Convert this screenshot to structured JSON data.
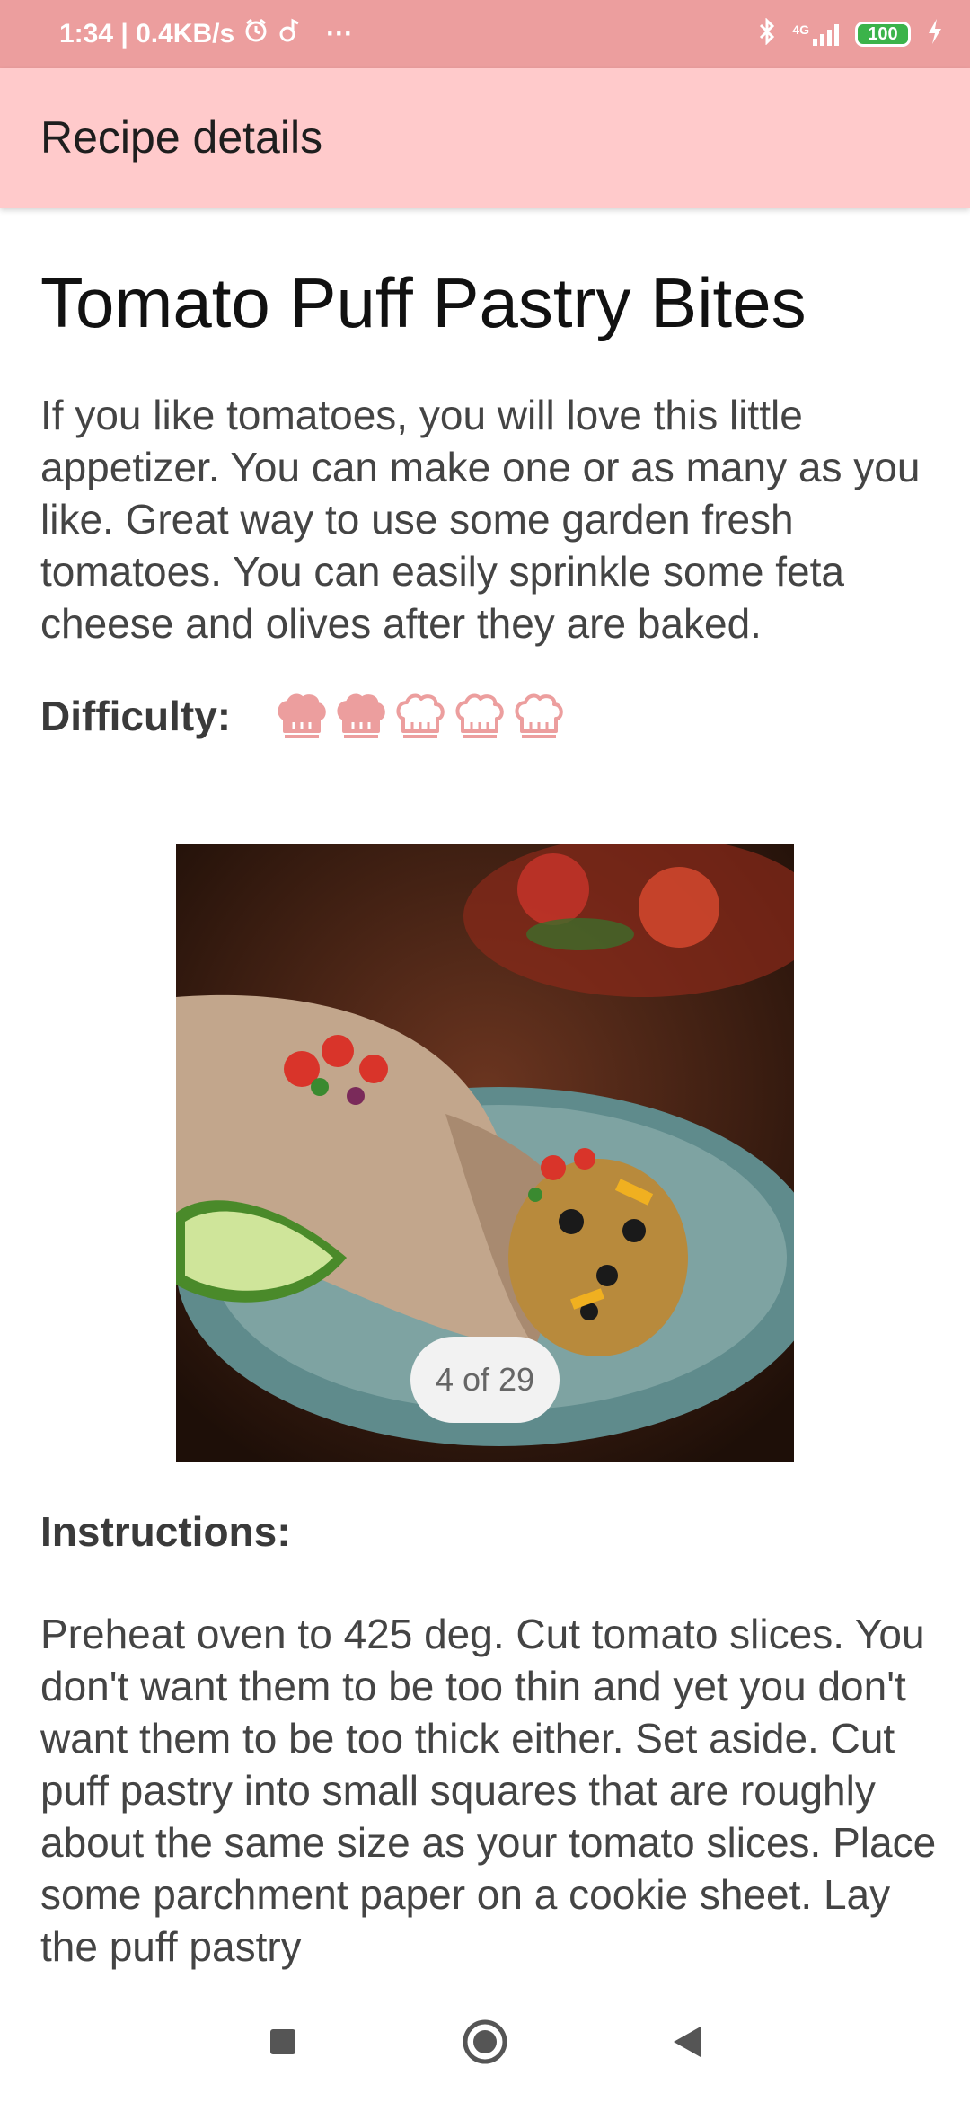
{
  "status_bar": {
    "time_speed": "1:34 | 0.4KB/s",
    "more": "···",
    "network": "4G",
    "battery": "100"
  },
  "app_bar": {
    "title": "Recipe details"
  },
  "recipe": {
    "title": "Tomato Puff Pastry Bites",
    "description": "If you like tomatoes, you will love this little appetizer. You can make one or as many as you like. Great way to use some garden fresh tomatoes. You can easily sprinkle some feta cheese and olives after they are baked.",
    "difficulty_label": "Difficulty:",
    "difficulty_level": 2,
    "difficulty_max": 5,
    "image_counter": "4 of 29",
    "instructions_label": "Instructions:",
    "instructions_text": "Preheat oven to 425 deg. Cut tomato slices. You don't want them to be too thin and yet you don't want them to be too thick either. Set aside. Cut puff pastry into small squares that are roughly about the same size as your tomato slices. Place some parchment paper on a cookie sheet. Lay the puff pastry"
  },
  "colors": {
    "status_bar": "#ec9e9e",
    "app_bar": "#ffcacb",
    "chef_hat": "#ec9e9e"
  },
  "icons": {
    "alarm": "alarm-icon",
    "music": "music-note-icon",
    "bluetooth": "bluetooth-icon",
    "signal": "signal-icon",
    "charging": "charging-bolt-icon",
    "difficulty": "chef-hat-icon",
    "nav_recents": "square-icon",
    "nav_home": "circle-icon",
    "nav_back": "triangle-back-icon"
  }
}
